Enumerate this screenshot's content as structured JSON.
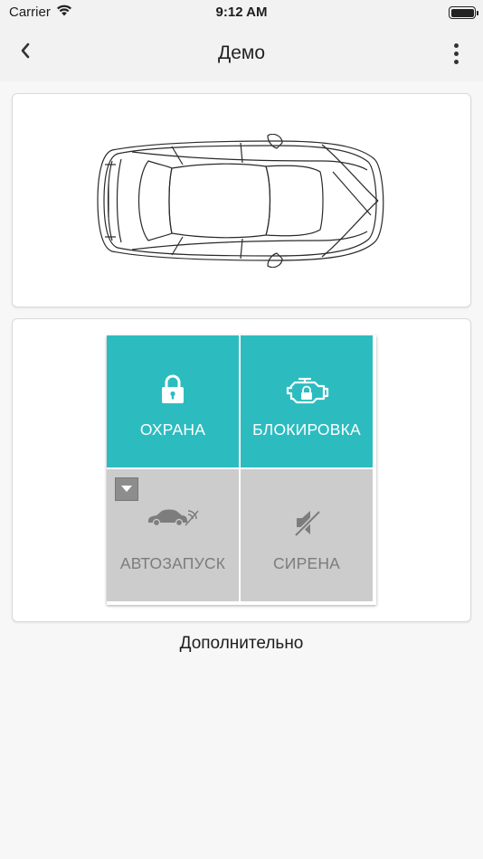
{
  "status_bar": {
    "carrier": "Carrier",
    "time": "9:12 AM",
    "icons": [
      "wifi-icon",
      "battery-icon"
    ]
  },
  "nav": {
    "title": "Демо",
    "back_icon": "chevron-left-icon",
    "menu_icon": "more-vertical-icon"
  },
  "car": {
    "icon": "car-top-view-icon"
  },
  "controls": {
    "tiles": [
      {
        "label": "ОХРАНА",
        "icon": "lock-icon",
        "state": "active"
      },
      {
        "label": "БЛОКИРОВКА",
        "icon": "engine-lock-icon",
        "state": "active"
      },
      {
        "label": "АВТОЗАПУСК",
        "icon": "car-remote-start-icon",
        "state": "inactive",
        "has_dropdown": true
      },
      {
        "label": "СИРЕНА",
        "icon": "speaker-mute-icon",
        "state": "inactive"
      }
    ]
  },
  "more_link": "Дополнительно",
  "colors": {
    "accent": "#2cbcc0",
    "inactive_tile": "#cccccc",
    "inactive_text": "#7c7c7c",
    "background": "#f7f7f7"
  }
}
